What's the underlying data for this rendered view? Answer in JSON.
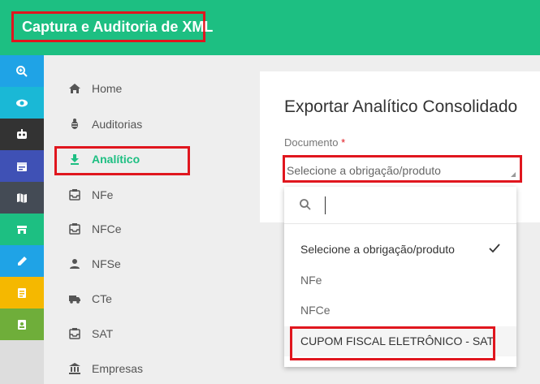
{
  "header": {
    "title": "Captura e Auditoria de XML"
  },
  "rail": {
    "buttons": [
      {
        "icon": "zoom-in-icon",
        "color": "#1fa3e6"
      },
      {
        "icon": "eye-icon",
        "color": "#1ab8d6"
      },
      {
        "icon": "robot-icon",
        "color": "#333333"
      },
      {
        "icon": "calendar-icon",
        "color": "#3f51b5"
      },
      {
        "icon": "map-icon",
        "color": "#444b55"
      },
      {
        "icon": "store-icon",
        "color": "#1dbf82"
      },
      {
        "icon": "pencil-icon",
        "color": "#1fa3e6"
      },
      {
        "icon": "receipt-icon",
        "color": "#f5b800"
      },
      {
        "icon": "badge-icon",
        "color": "#6fae3a"
      }
    ]
  },
  "sidebar": {
    "items": [
      {
        "label": "Home",
        "icon": "home-icon"
      },
      {
        "label": "Auditorias",
        "icon": "bug-icon"
      },
      {
        "label": "Analítico",
        "icon": "download-icon",
        "active": true
      },
      {
        "label": "NFe",
        "icon": "inbox-icon"
      },
      {
        "label": "NFCe",
        "icon": "inbox-icon"
      },
      {
        "label": "NFSe",
        "icon": "person-icon"
      },
      {
        "label": "CTe",
        "icon": "truck-icon"
      },
      {
        "label": "SAT",
        "icon": "inbox-icon"
      },
      {
        "label": "Empresas",
        "icon": "bank-icon"
      }
    ]
  },
  "main": {
    "title": "Exportar Analítico Consolidado",
    "field_label": "Documento",
    "required_mark": "*",
    "select_value": "Selecione a obrigação/produto"
  },
  "dropdown": {
    "search_placeholder": "",
    "options": [
      {
        "label": "Selecione a obrigação/produto",
        "selected": true
      },
      {
        "label": "NFe",
        "selected": false
      },
      {
        "label": "NFCe",
        "selected": false
      },
      {
        "label": "CUPOM FISCAL ELETRÔNICO - SAT",
        "selected": false
      }
    ]
  },
  "colors": {
    "brand": "#1dbf82",
    "highlight": "#e0161e"
  }
}
